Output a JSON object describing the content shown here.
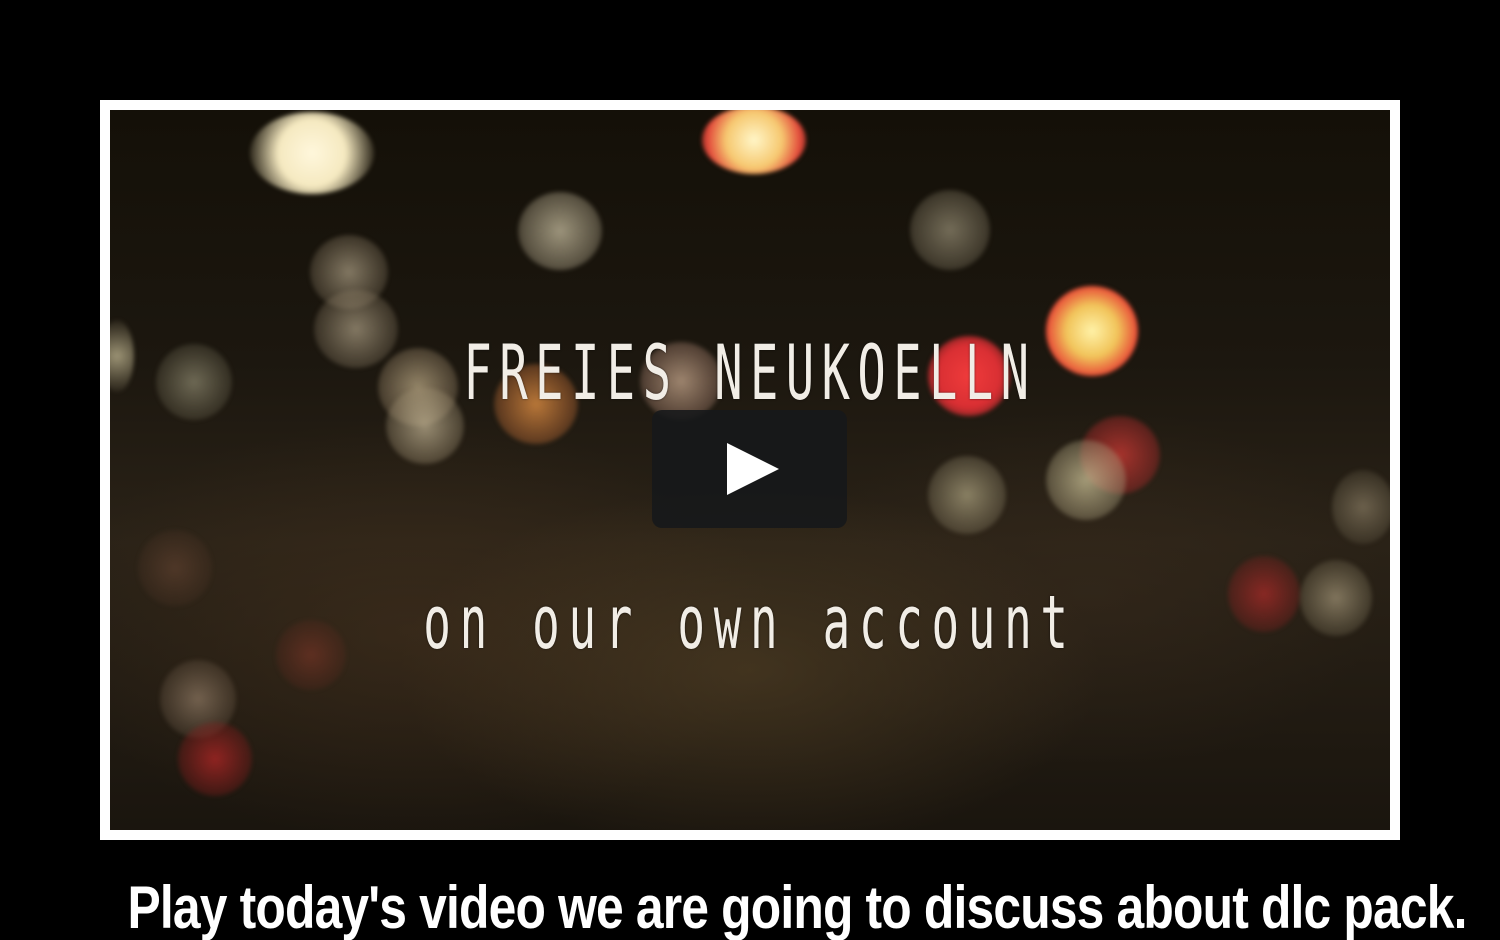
{
  "video": {
    "title_main": "FREIES NEUKOELLN",
    "title_sub": "on our own account",
    "play_icon": "play-icon"
  },
  "caption": {
    "text": "Play today's video we are going to discuss about dlc pack."
  },
  "colors": {
    "background": "#000000",
    "frame_border": "#ffffff",
    "caption_text": "#ffffff",
    "play_button_bg": "#16181a"
  }
}
